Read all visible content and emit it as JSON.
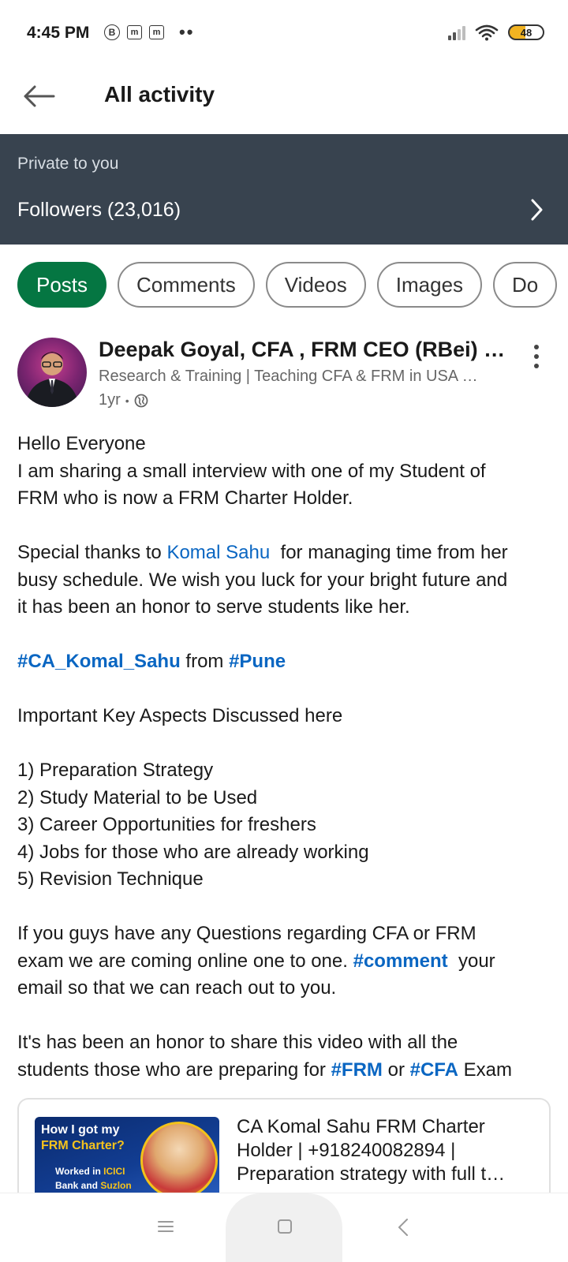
{
  "status_bar": {
    "time": "4:45 PM",
    "left_icons": [
      "B",
      "m",
      "m"
    ],
    "dots": "••",
    "battery": "48"
  },
  "header": {
    "title": "All activity",
    "back_icon": "arrow-left-icon"
  },
  "banner": {
    "private_label": "Private to you",
    "followers_text": "Followers (23,016)",
    "chevron_icon": "chevron-right-icon"
  },
  "filters": {
    "chips": [
      {
        "label": "Posts",
        "active": true
      },
      {
        "label": "Comments",
        "active": false
      },
      {
        "label": "Videos",
        "active": false
      },
      {
        "label": "Images",
        "active": false
      },
      {
        "label": "Do",
        "active": false
      }
    ]
  },
  "post": {
    "author": "Deepak Goyal, CFA , FRM CEO (RBei) …",
    "headline": "Research & Training | Teaching CFA & FRM in USA …",
    "time": "1yr",
    "dot": "•",
    "visibility_icon": "globe-icon",
    "body": {
      "l1": "Hello Everyone",
      "l2": "I am sharing a small interview with one of my Student of",
      "l3": "FRM who is now a FRM Charter Holder.",
      "l5a": "Special thanks to ",
      "l5_mention": "Komal Sahu",
      "l5b": "  for managing time from her",
      "l6": "busy schedule. We wish you luck for your bright future and",
      "l7": "it has been an honor to serve students like her.",
      "l9_tag1": "#CA_Komal_Sahu",
      "l9_mid": " from ",
      "l9_tag2": "#Pune",
      "l11": "Important Key Aspects Discussed here",
      "l13": "1) Preparation Strategy",
      "l14": "2) Study Material to be Used",
      "l15": "3) Career Opportunities for freshers",
      "l16": "4) Jobs for those who are already working",
      "l17": "5) Revision Technique",
      "l19": "If you guys have any Questions regarding CFA or FRM",
      "l20a": "exam we are coming online one to one. ",
      "l20_tag": "#comment",
      "l20b": "  your",
      "l21": "email so that we can reach out to you.",
      "l23": "It's has been an honor to share this video with all the",
      "l24a": "students those who are preparing for ",
      "l24_tag1": "#FRM",
      "l24_or": " or ",
      "l24_tag2": "#CFA",
      "l24b": " Exam"
    }
  },
  "preview": {
    "thumb_line1": "How I got my",
    "thumb_line2": "FRM Charter?",
    "thumb_line3a": "Worked in ",
    "thumb_line3b": "ICICI",
    "thumb_line4a": "Bank and ",
    "thumb_line4b": "Suzlon",
    "title": "CA Komal Sahu FRM Charter Holder | +918240082894 | Preparation strategy with full t…"
  },
  "nav": {
    "menu_icon": "menu-icon",
    "home_icon": "home-square-icon",
    "back_icon": "back-triangle-icon"
  },
  "colors": {
    "banner_bg": "#38434f",
    "chip_active": "#057642",
    "link": "#0a66c2",
    "battery": "#f2b321"
  }
}
